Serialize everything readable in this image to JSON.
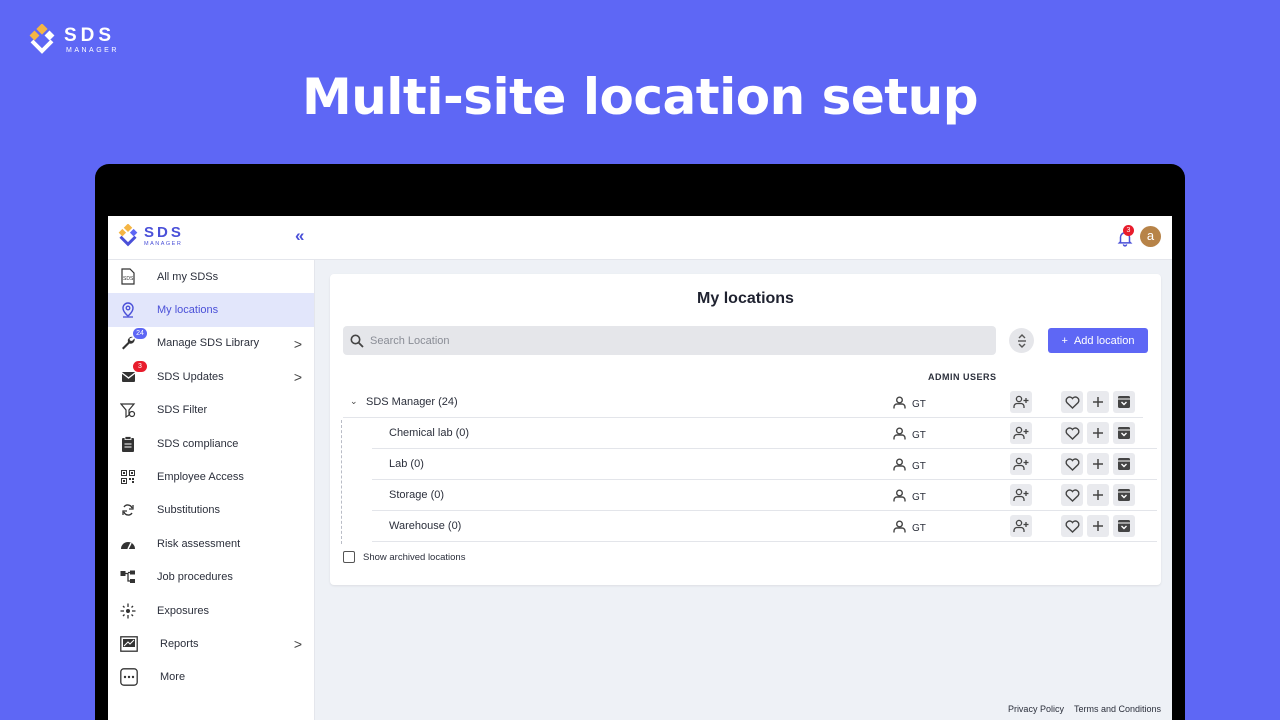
{
  "brand": {
    "name": "SDS",
    "sub": "MANAGER"
  },
  "headline": "Multi-site location setup",
  "app": {
    "logo_name": "SDS",
    "logo_sub": "MANAGER",
    "collapse_label": "«",
    "notification_count": "3",
    "avatar_letter": "a"
  },
  "sidebar": {
    "items": [
      {
        "label": "All my SDSs",
        "icon": "sds-document-icon"
      },
      {
        "label": "My locations",
        "icon": "location-pin-icon",
        "active": true
      },
      {
        "label": "Manage SDS Library",
        "icon": "wrench-icon",
        "badge": "24",
        "badge_color": "#5e67f5",
        "chevron": ">"
      },
      {
        "label": "SDS Updates",
        "icon": "mail-icon",
        "badge": "3",
        "badge_color": "#e81c2c",
        "chevron": ">"
      },
      {
        "label": "SDS Filter",
        "icon": "filter-icon"
      },
      {
        "label": "SDS compliance",
        "icon": "clipboard-icon"
      },
      {
        "label": "Employee Access",
        "icon": "qr-code-icon"
      },
      {
        "label": "Substitutions",
        "icon": "swap-icon"
      },
      {
        "label": "Risk assessment",
        "icon": "gauge-icon"
      },
      {
        "label": "Job procedures",
        "icon": "flow-chart-icon"
      },
      {
        "label": "Exposures",
        "icon": "exposure-icon"
      },
      {
        "label": "Reports",
        "icon": "report-icon",
        "chevron": ">"
      },
      {
        "label": "More",
        "icon": "more-icon"
      }
    ]
  },
  "main": {
    "title": "My locations",
    "search_placeholder": "Search Location",
    "add_label": "Add location",
    "admin_users_header": "ADMIN USERS",
    "root": {
      "name": "SDS Manager (24)",
      "admin": "GT"
    },
    "children": [
      {
        "name": "Chemical lab (0)",
        "admin": "GT"
      },
      {
        "name": "Lab (0)",
        "admin": "GT"
      },
      {
        "name": "Storage (0)",
        "admin": "GT"
      },
      {
        "name": "Warehouse (0)",
        "admin": "GT"
      }
    ],
    "show_archived_label": "Show archived locations"
  },
  "footer": {
    "privacy": "Privacy Policy",
    "terms": "Terms and Conditions"
  },
  "colors": {
    "background": "#5e67f5",
    "accent": "#4a50d8",
    "badge_red": "#e81c2c"
  }
}
